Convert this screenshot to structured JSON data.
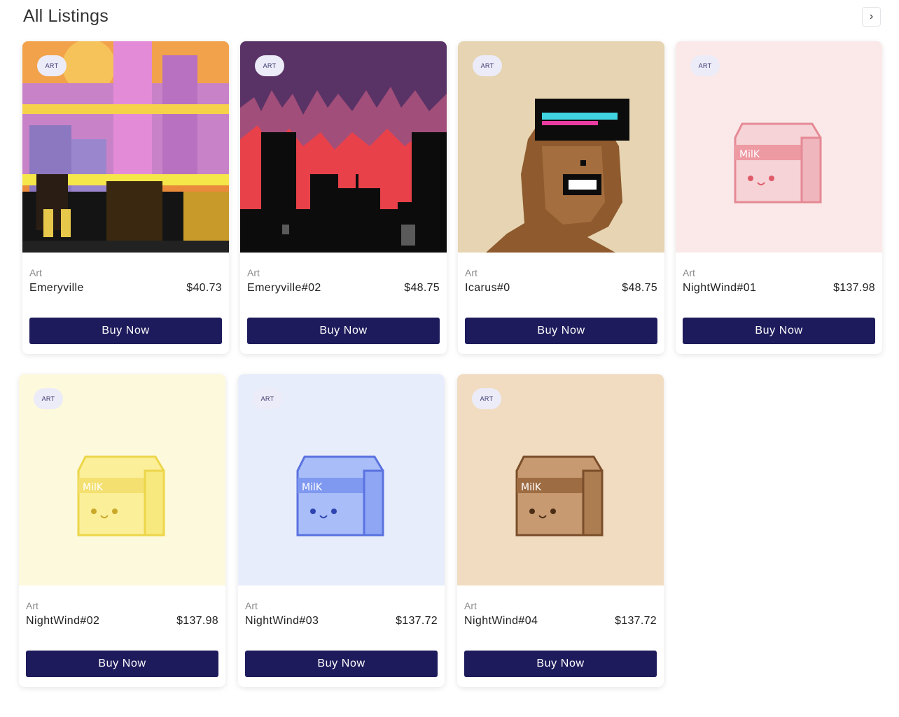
{
  "header": {
    "title": "All Listings",
    "next_label": "›"
  },
  "listings": [
    {
      "badge": "ART",
      "category": "Art",
      "name": "Emeryville",
      "price": "$40.73",
      "button": "Buy Now",
      "art": "city-sunset"
    },
    {
      "badge": "ART",
      "category": "Art",
      "name": "Emeryville#02",
      "price": "$48.75",
      "button": "Buy Now",
      "art": "city-red"
    },
    {
      "badge": "ART",
      "category": "Art",
      "name": "Icarus#0",
      "price": "$48.75",
      "button": "Buy Now",
      "art": "pixel-ape"
    },
    {
      "badge": "ART",
      "category": "Art",
      "name": "NightWind#01",
      "price": "$137.98",
      "button": "Buy Now",
      "art": "milk-pink"
    },
    {
      "badge": "ART",
      "category": "Art",
      "name": "NightWind#02",
      "price": "$137.98",
      "button": "Buy Now",
      "art": "milk-yellow"
    },
    {
      "badge": "ART",
      "category": "Art",
      "name": "NightWind#03",
      "price": "$137.72",
      "button": "Buy Now",
      "art": "milk-blue"
    },
    {
      "badge": "ART",
      "category": "Art",
      "name": "NightWind#04",
      "price": "$137.72",
      "button": "Buy Now",
      "art": "milk-brown"
    }
  ],
  "milk_label": "MilK",
  "colors": {
    "button": "#1e1b5c",
    "badge_bg": "#ecebf8",
    "milk_pink_bg": "#fbe9e9",
    "milk_yellow_bg": "#fdf9dc",
    "milk_blue_bg": "#e8edfb",
    "milk_brown_bg": "#f1dcc1",
    "ape_bg": "#e6d4b2",
    "city_red_sky": "#5a3366"
  }
}
